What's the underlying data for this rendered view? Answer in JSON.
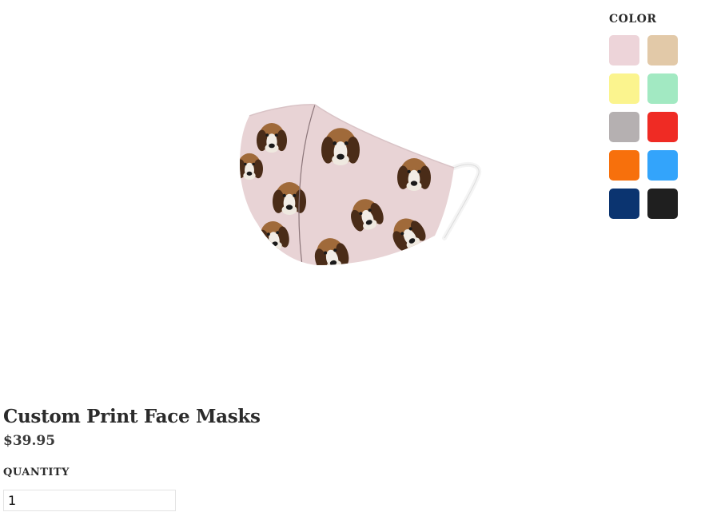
{
  "product": {
    "title": "Custom Print Face Masks",
    "price": "$39.95",
    "image_icon": "face-mask-beagle-print-image"
  },
  "color": {
    "label": "COLOR",
    "swatches": [
      {
        "name": "pink",
        "hex": "#edd4d9"
      },
      {
        "name": "tan",
        "hex": "#e2c9a8"
      },
      {
        "name": "yellow",
        "hex": "#fbf48e"
      },
      {
        "name": "mint",
        "hex": "#a2e9c2"
      },
      {
        "name": "gray",
        "hex": "#b5b0b1"
      },
      {
        "name": "red",
        "hex": "#ef2b24"
      },
      {
        "name": "orange",
        "hex": "#f7700c"
      },
      {
        "name": "sky-blue",
        "hex": "#33a4fb"
      },
      {
        "name": "navy",
        "hex": "#0b3470"
      },
      {
        "name": "black",
        "hex": "#1f1f1f"
      }
    ]
  },
  "quantity": {
    "label": "QUANTITY",
    "value": "1"
  }
}
